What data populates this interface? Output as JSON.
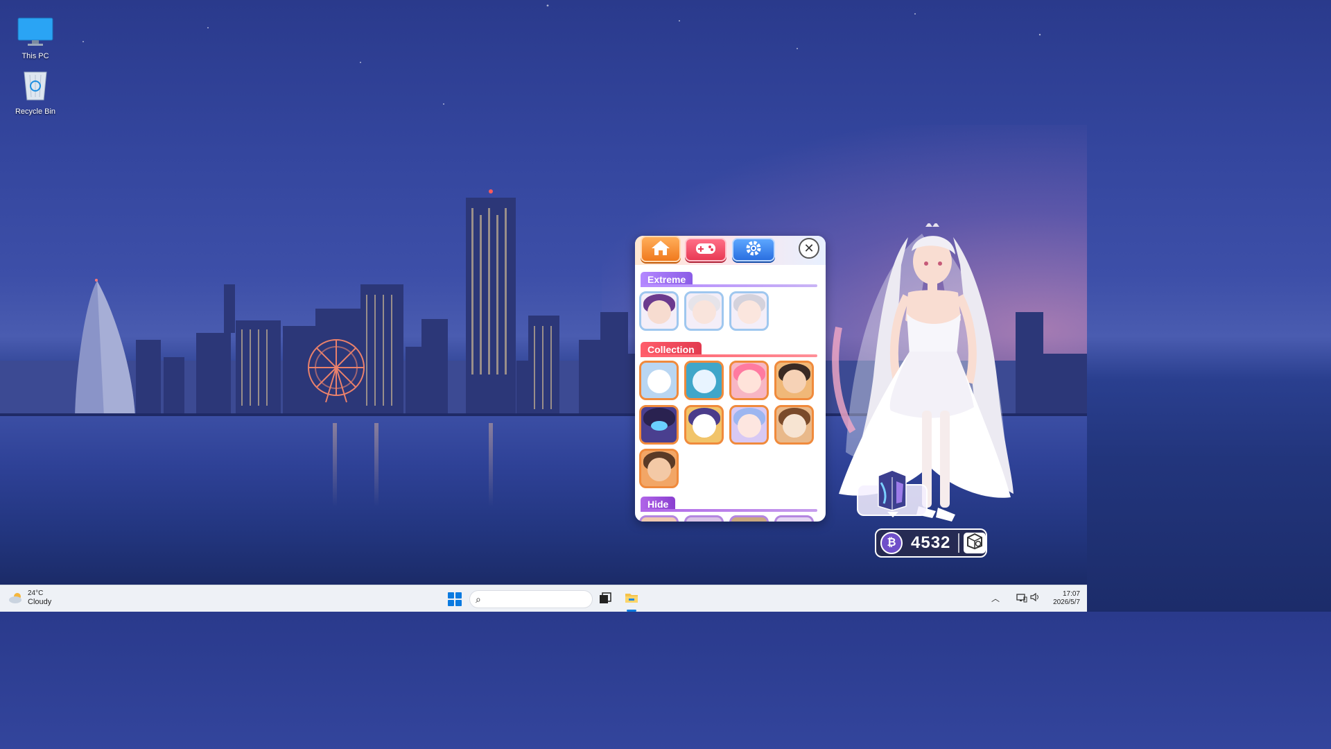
{
  "desktop": {
    "icons": [
      {
        "label": "This PC",
        "icon": "monitor-icon"
      },
      {
        "label": "Recycle Bin",
        "icon": "recycle-bin-icon"
      }
    ]
  },
  "widget": {
    "tabs": [
      {
        "name": "home",
        "icon": "home-icon",
        "color": "#f07a1e"
      },
      {
        "name": "games",
        "icon": "gamepad-icon",
        "color": "#e83a55"
      },
      {
        "name": "settings",
        "icon": "gear-icon",
        "color": "#2a6fe0"
      }
    ],
    "close_icon": "close-icon",
    "sections": {
      "extreme": {
        "title": "Extreme",
        "color": "#8a5ce6",
        "items": 3
      },
      "collection": {
        "title": "Collection",
        "color": "#e23a4f",
        "items": 9
      },
      "hide": {
        "title": "Hide",
        "color": "#8a3fd0"
      }
    }
  },
  "points": {
    "value": "4532",
    "coin_icon": "coin-icon",
    "shop_icon": "shop-box-icon"
  },
  "taskbar": {
    "weather": {
      "temp": "24°C",
      "condition": "Cloudy",
      "icon": "cloud-sun-icon"
    },
    "start_icon": "windows-start-icon",
    "search_icon": "search-icon",
    "pinned": [
      {
        "name": "task-view",
        "icon": "task-view-icon"
      },
      {
        "name": "file-explorer",
        "icon": "folder-icon",
        "active": true
      }
    ],
    "tray": {
      "chevron_icon": "chevron-up-icon",
      "network_icon": "network-icon",
      "volume_icon": "speaker-icon"
    },
    "clock": {
      "time": "17:07",
      "date": "2026/5/7"
    }
  }
}
